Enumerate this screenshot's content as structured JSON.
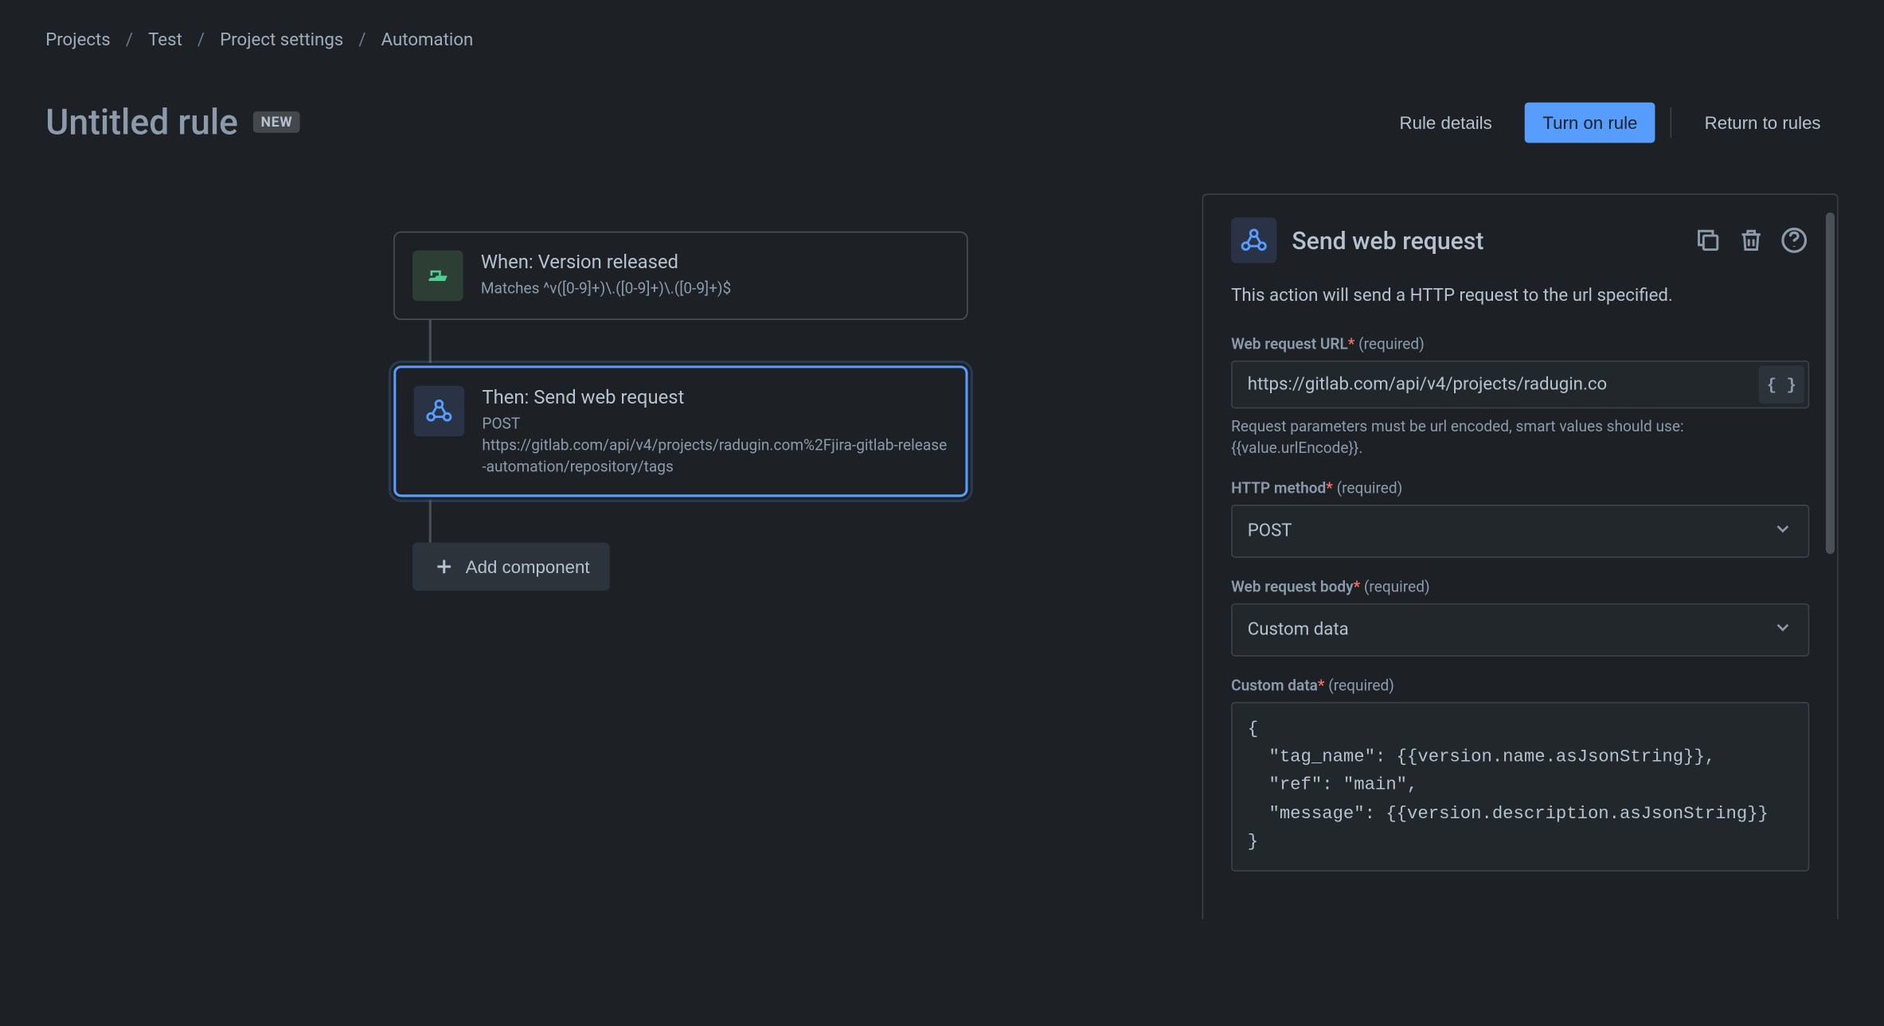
{
  "breadcrumb": {
    "items": [
      "Projects",
      "Test",
      "Project settings",
      "Automation"
    ]
  },
  "header": {
    "title": "Untitled rule",
    "badge": "NEW",
    "rule_details_label": "Rule details",
    "turn_on_rule_label": "Turn on rule",
    "return_to_rules_label": "Return to rules"
  },
  "flow": {
    "trigger": {
      "title": "When: Version released",
      "subtitle": "Matches ^v([0-9]+)\\.([0-9]+)\\.([0-9]+)$"
    },
    "action": {
      "title": "Then: Send web request",
      "method": "POST",
      "url": "https://gitlab.com/api/v4/projects/radugin.com%2Fjira-gitlab-release-automation/repository/tags"
    },
    "add_component_label": "Add component"
  },
  "panel": {
    "title": "Send web request",
    "description": "This action will send a HTTP request to the url specified.",
    "url_field": {
      "label": "Web request URL",
      "required_text": "(required)",
      "value": "https://gitlab.com/api/v4/projects/radugin.co",
      "hint": "Request parameters must be url encoded, smart values should use: {{value.urlEncode}}.",
      "suffix_btn": "{ }"
    },
    "method_field": {
      "label": "HTTP method",
      "required_text": "(required)",
      "value": "POST"
    },
    "body_field": {
      "label": "Web request body",
      "required_text": "(required)",
      "value": "Custom data"
    },
    "custom_data_field": {
      "label": "Custom data",
      "required_text": "(required)",
      "value": "{\n  \"tag_name\": {{version.name.asJsonString}},\n  \"ref\": \"main\",\n  \"message\": {{version.description.asJsonString}}\n}"
    }
  }
}
